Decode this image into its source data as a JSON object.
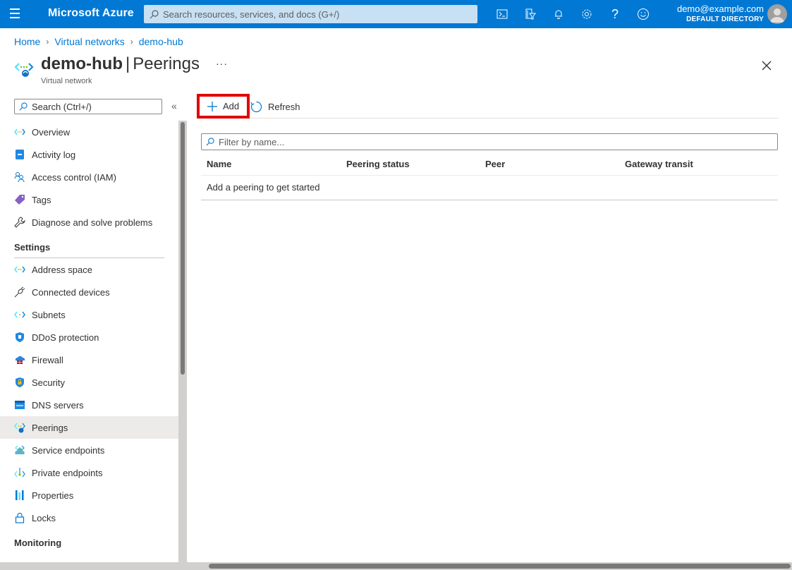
{
  "topbar": {
    "brand": "Microsoft Azure",
    "search_placeholder": "Search resources, services, and docs (G+/)",
    "icons": [
      "cloud-shell-icon",
      "directory-filter-icon",
      "notifications-icon",
      "settings-icon",
      "help-icon",
      "feedback-icon"
    ],
    "account_email": "demo@example.com",
    "account_directory": "DEFAULT DIRECTORY"
  },
  "breadcrumb": [
    "Home",
    "Virtual networks",
    "demo-hub"
  ],
  "page": {
    "resource_name": "demo-hub",
    "separator": "|",
    "blade_name": "Peerings",
    "more": "···",
    "subtitle": "Virtual network"
  },
  "sidebar": {
    "search_placeholder": "Search (Ctrl+/)",
    "collapse_glyph": "«",
    "items": [
      {
        "label": "Overview",
        "icon": "overview-icon"
      },
      {
        "label": "Activity log",
        "icon": "activity-log-icon"
      },
      {
        "label": "Access control (IAM)",
        "icon": "iam-icon"
      },
      {
        "label": "Tags",
        "icon": "tag-icon"
      },
      {
        "label": "Diagnose and solve problems",
        "icon": "wrench-icon"
      }
    ],
    "settings_header": "Settings",
    "settings_items": [
      {
        "label": "Address space",
        "icon": "address-space-icon"
      },
      {
        "label": "Connected devices",
        "icon": "plug-icon"
      },
      {
        "label": "Subnets",
        "icon": "subnets-icon"
      },
      {
        "label": "DDoS protection",
        "icon": "shield-icon"
      },
      {
        "label": "Firewall",
        "icon": "firewall-icon"
      },
      {
        "label": "Security",
        "icon": "security-shield-icon"
      },
      {
        "label": "DNS servers",
        "icon": "dns-icon"
      },
      {
        "label": "Peerings",
        "icon": "peerings-icon",
        "active": true
      },
      {
        "label": "Service endpoints",
        "icon": "service-endpoints-icon"
      },
      {
        "label": "Private endpoints",
        "icon": "private-endpoints-icon"
      },
      {
        "label": "Properties",
        "icon": "properties-icon"
      },
      {
        "label": "Locks",
        "icon": "lock-icon"
      }
    ],
    "monitoring_header": "Monitoring"
  },
  "commands": {
    "add": "Add",
    "refresh": "Refresh"
  },
  "filter": {
    "placeholder": "Filter by name..."
  },
  "grid": {
    "columns": [
      "Name",
      "Peering status",
      "Peer",
      "Gateway transit"
    ],
    "empty_message": "Add a peering to get started"
  },
  "colors": {
    "brand_blue": "#0078d4",
    "highlight_red": "#e00000",
    "active_item_bg": "#edebe9"
  }
}
